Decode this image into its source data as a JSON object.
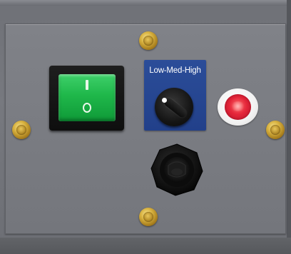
{
  "panel": {
    "knob_label": "Low-Med-High"
  },
  "switch": {
    "on_symbol": "I",
    "off_symbol": "O",
    "color": "#1fb74a"
  },
  "knob_panel_color": "#22408a",
  "indicator": {
    "color": "#e4263a"
  },
  "icons": [
    "screw-icon",
    "rocker-switch",
    "rotary-knob",
    "indicator-lamp",
    "fuse-holder"
  ]
}
